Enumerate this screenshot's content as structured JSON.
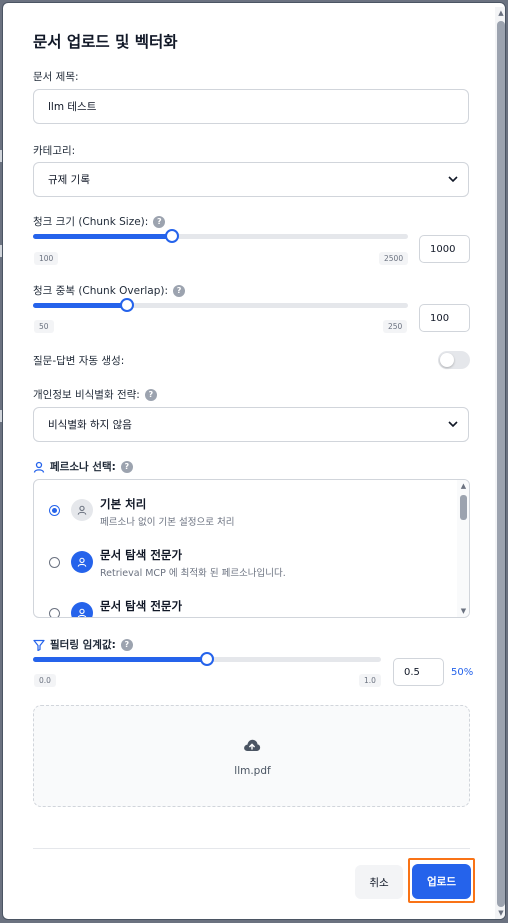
{
  "modal": {
    "title": "문서 업로드 및 벡터화"
  },
  "doc_title": {
    "label": "문서 제목:",
    "value": "llm 테스트"
  },
  "category": {
    "label": "카테고리:",
    "value": "규제 기록"
  },
  "chunk_size": {
    "label": "청크 크기 (Chunk Size):",
    "min": "100",
    "max": "2500",
    "value": "1000",
    "fraction": 0.37
  },
  "chunk_overlap": {
    "label": "청크 중복 (Chunk Overlap):",
    "min": "50",
    "max": "250",
    "value": "100",
    "fraction": 0.25
  },
  "qa_toggle": {
    "label": "질문-답변 자동 생성:",
    "on": false
  },
  "privacy": {
    "label": "개인정보 비식별화 전략:",
    "value": "비식별화 하지 않음"
  },
  "persona": {
    "label": "페르소나 선택:",
    "items": [
      {
        "name": "기본 처리",
        "desc": "페르소나 없이 기본 설정으로 처리",
        "selected": true,
        "avatar": "grey"
      },
      {
        "name": "문서 탐색 전문가",
        "desc": "Retrieval MCP 에 최적화 된 페르소나입니다.",
        "selected": false,
        "avatar": "blue"
      },
      {
        "name": "문서 탐색 전문가",
        "desc": "",
        "selected": false,
        "avatar": "blue"
      }
    ]
  },
  "filter_threshold": {
    "label": "필터링 임계값:",
    "min": "0.0",
    "max": "1.0",
    "value": "0.5",
    "percent": "50%",
    "fraction": 0.5
  },
  "upload": {
    "file_name": "llm.pdf"
  },
  "buttons": {
    "cancel": "취소",
    "upload": "업로드"
  },
  "colors": {
    "accent": "#2563eb",
    "focus_ring": "#f97316"
  },
  "icons": {
    "help": "?",
    "persona": "user-icon",
    "filter": "filter-icon",
    "cloud": "cloud-upload-icon"
  }
}
